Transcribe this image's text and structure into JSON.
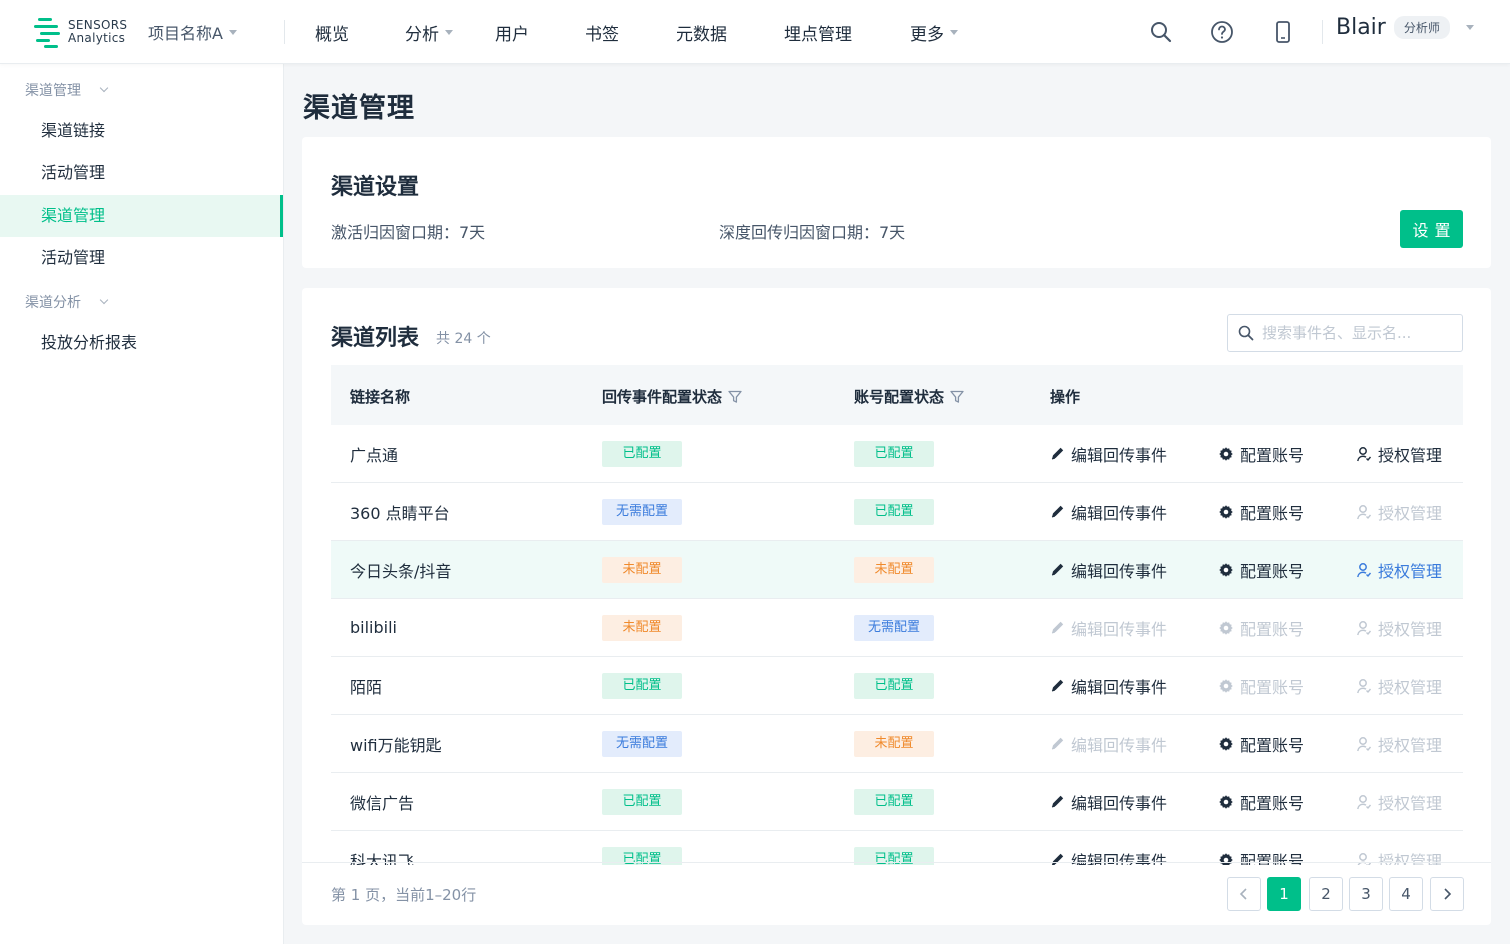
{
  "brand": {
    "line1": "SENSORS",
    "line2": "Analytics",
    "accent": "#00bf8a"
  },
  "project": {
    "name": "项目名称A"
  },
  "nav": [
    {
      "label": "概览",
      "dropdown": false
    },
    {
      "label": "分析",
      "dropdown": true
    },
    {
      "label": "用户",
      "dropdown": false
    },
    {
      "label": "书签",
      "dropdown": false
    },
    {
      "label": "元数据",
      "dropdown": false
    },
    {
      "label": "埋点管理",
      "dropdown": false
    },
    {
      "label": "更多",
      "dropdown": true
    }
  ],
  "header_icons": [
    "search-icon",
    "help-icon",
    "mobile-icon"
  ],
  "user": {
    "name": "Blair",
    "role": "分析师"
  },
  "sidebar": {
    "group1": "渠道管理",
    "group1_items": [
      "渠道链接",
      "活动管理",
      "渠道管理",
      "活动管理"
    ],
    "active_index": 2,
    "group2": "渠道分析",
    "group2_items": [
      "投放分析报表"
    ]
  },
  "page": {
    "title": "渠道管理"
  },
  "settings": {
    "title": "渠道设置",
    "activation_window": "激活归因窗口期：7天",
    "deep_window": "深度回传归因窗口期：7天",
    "button": "设置"
  },
  "channel_list": {
    "title": "渠道列表",
    "count": "共 24 个",
    "search_placeholder": "搜索事件名、显示名...",
    "columns": [
      "链接名称",
      "回传事件配置状态",
      "账号配置状态",
      "操作"
    ],
    "actions": [
      "编辑回传事件",
      "配置账号",
      "授权管理"
    ],
    "rows": [
      {
        "name": "广点通",
        "event_status": "已配置",
        "account_status": "已配置"
      },
      {
        "name": "360 点睛平台",
        "event_status": "无需配置",
        "account_status": "已配置"
      },
      {
        "name": "今日头条/抖音",
        "event_status": "未配置",
        "account_status": "未配置"
      },
      {
        "name": "bilibili",
        "event_status": "未配置",
        "account_status": "无需配置"
      },
      {
        "name": "陌陌",
        "event_status": "已配置",
        "account_status": "已配置"
      },
      {
        "name": "wifi万能钥匙",
        "event_status": "无需配置",
        "account_status": "未配置"
      },
      {
        "name": "微信广告",
        "event_status": "已配置",
        "account_status": "已配置"
      },
      {
        "name": "科大讯飞",
        "event_status": "已配置",
        "account_status": "已配置"
      }
    ]
  },
  "pagination": {
    "info": "第 1 页，当前1–20行",
    "pages": [
      "1",
      "2",
      "3",
      "4"
    ],
    "current": "1"
  },
  "colors": {
    "configured": "#00bf8a",
    "not_needed": "#3a7bdc",
    "unconfigured": "#f08a2c",
    "disabled": "#c0c8d2"
  }
}
